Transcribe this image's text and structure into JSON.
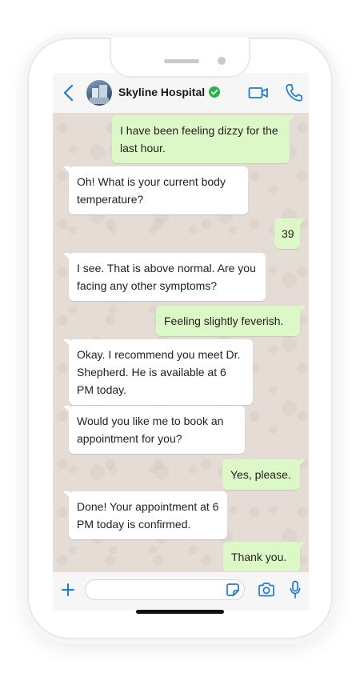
{
  "header": {
    "contact_name": "Skyline Hospital",
    "verified": true
  },
  "colors": {
    "accent": "#1e7bd3",
    "verified_green": "#25b34a",
    "outgoing_bubble": "#dcf8c6",
    "incoming_bubble": "#ffffff",
    "chat_background": "#e5ddd5"
  },
  "icons": {
    "back": "chevron-left-icon",
    "verified": "verified-check-icon",
    "video_call": "video-camera-icon",
    "voice_call": "phone-handset-icon",
    "attach": "plus-icon",
    "sticker": "sticker-icon",
    "camera": "camera-icon",
    "mic": "microphone-icon"
  },
  "messages": [
    {
      "direction": "out",
      "text": "I have been feeling dizzy for the last hour."
    },
    {
      "direction": "in",
      "text": "Oh! What is your current body temperature?"
    },
    {
      "direction": "out",
      "text": "39"
    },
    {
      "direction": "in",
      "text": "I see. That is above normal. Are you facing any other symptoms?"
    },
    {
      "direction": "out",
      "text": "Feeling slightly feverish."
    },
    {
      "direction": "in",
      "text": "Okay. I recommend you meet Dr. Shepherd. He is available at 6 PM today."
    },
    {
      "direction": "in",
      "text": "Would you like me to book an appointment for you?"
    },
    {
      "direction": "out",
      "text": "Yes, please."
    },
    {
      "direction": "in",
      "text": "Done! Your appointment at 6 PM today is confirmed."
    },
    {
      "direction": "out",
      "text": "Thank you."
    }
  ],
  "composer": {
    "value": "",
    "placeholder": ""
  }
}
